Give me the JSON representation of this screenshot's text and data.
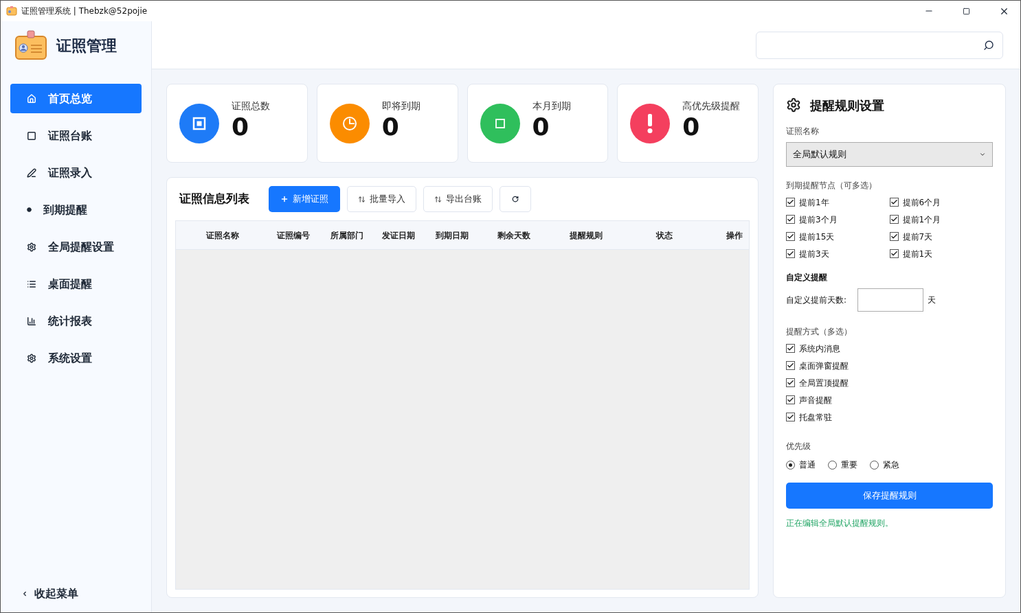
{
  "window": {
    "title": "证照管理系统 | Thebzk@52pojie"
  },
  "app": {
    "name": "证照管理"
  },
  "nav": {
    "items": [
      {
        "label": "首页总览",
        "selected": true
      },
      {
        "label": "证照台账",
        "selected": false
      },
      {
        "label": "证照录入",
        "selected": false
      },
      {
        "label": "到期提醒",
        "selected": false
      },
      {
        "label": "全局提醒设置",
        "selected": false
      },
      {
        "label": "桌面提醒",
        "selected": false
      },
      {
        "label": "统计报表",
        "selected": false
      },
      {
        "label": "系统设置",
        "selected": false
      }
    ],
    "collapse_label": "收起菜单"
  },
  "stats": [
    {
      "label": "证照总数",
      "value": "0",
      "color": "#1e7bf7",
      "kind": "total"
    },
    {
      "label": "即将到期",
      "value": "0",
      "color": "#fb8c00",
      "kind": "soon"
    },
    {
      "label": "本月到期",
      "value": "0",
      "color": "#2fbf5c",
      "kind": "month"
    },
    {
      "label": "高优先级提醒",
      "value": "0",
      "color": "#f43f5e",
      "kind": "alert"
    }
  ],
  "list": {
    "title": "证照信息列表",
    "buttons": [
      {
        "label": "新增证照",
        "kind": "primary"
      },
      {
        "label": "批量导入",
        "kind": "import"
      },
      {
        "label": "导出台账",
        "kind": "export"
      },
      {
        "kind": "refresh"
      }
    ],
    "table": {
      "columns": [
        "证照名称",
        "证照编号",
        "所属部门",
        "发证日期",
        "到期日期",
        "剩余天数",
        "提醒规则",
        "状态",
        "操作"
      ]
    }
  },
  "rules": {
    "title": "提醒规则设置",
    "name_label": "证照名称",
    "name_value": "全局默认规则",
    "nodes_label": "到期提醒节点（可多选）",
    "nodes": [
      {
        "label": "提前1年",
        "checked": true
      },
      {
        "label": "提前6个月",
        "checked": true
      },
      {
        "label": "提前3个月",
        "checked": true
      },
      {
        "label": "提前1个月",
        "checked": true
      },
      {
        "label": "提前15天",
        "checked": true
      },
      {
        "label": "提前7天",
        "checked": true
      },
      {
        "label": "提前3天",
        "checked": true
      },
      {
        "label": "提前1天",
        "checked": true
      }
    ],
    "custom_title": "自定义提醒",
    "custom_label": "自定义提前天数:",
    "custom_unit": "天",
    "methods_label": "提醒方式（多选）",
    "methods": [
      {
        "label": "系统内消息",
        "checked": true
      },
      {
        "label": "桌面弹窗提醒",
        "checked": true
      },
      {
        "label": "全局置顶提醒",
        "checked": true
      },
      {
        "label": "声音提醒",
        "checked": true
      },
      {
        "label": "托盘常驻",
        "checked": true
      }
    ],
    "priority_label": "优先级",
    "priorities": [
      {
        "label": "普通",
        "selected": true
      },
      {
        "label": "重要",
        "selected": false
      },
      {
        "label": "紧急",
        "selected": false
      }
    ],
    "save_button": "保存提醒规则",
    "status": "正在编辑全局默认提醒规则。"
  }
}
